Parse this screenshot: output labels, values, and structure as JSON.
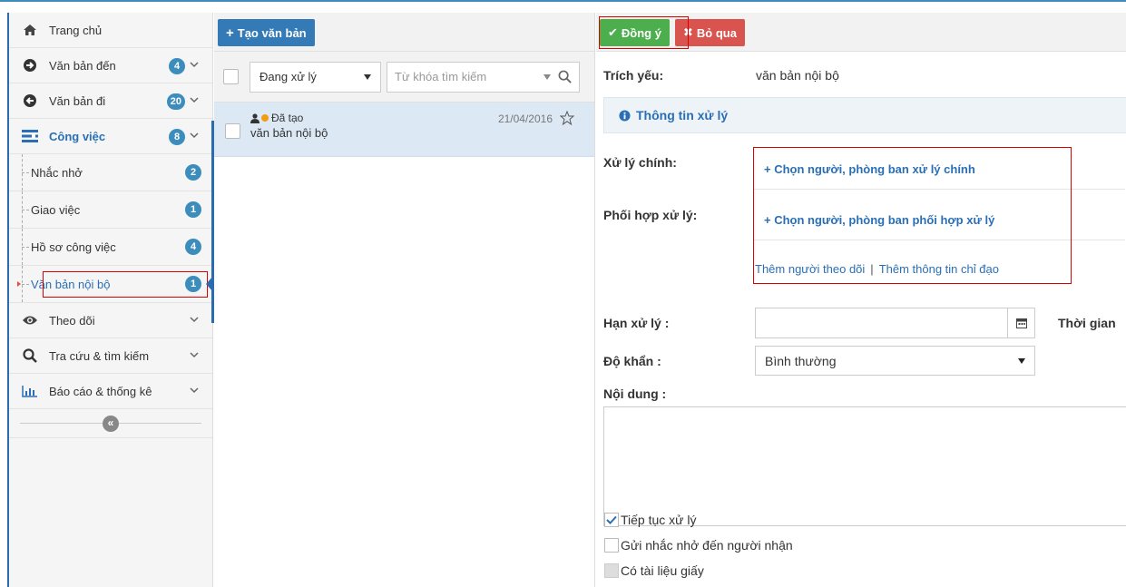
{
  "sidebar": {
    "items": [
      {
        "label": "Trang chủ",
        "icon": "home-icon"
      },
      {
        "label": "Văn bản đến",
        "icon": "arrow-circle-right-icon",
        "badge": "4"
      },
      {
        "label": "Văn bản đi",
        "icon": "arrow-circle-left-icon",
        "badge": "20"
      },
      {
        "label": "Công việc",
        "icon": "tasks-icon",
        "badge": "8"
      }
    ],
    "subitems": [
      {
        "label": "Nhắc nhở",
        "badge": "2"
      },
      {
        "label": "Giao việc",
        "badge": "1"
      },
      {
        "label": "Hồ sơ công việc",
        "badge": "4"
      },
      {
        "label": "Văn bản nội bộ",
        "badge": "1"
      }
    ],
    "more": [
      {
        "label": "Theo dõi",
        "icon": "eye-icon"
      },
      {
        "label": "Tra cứu & tìm kiếm",
        "icon": "search-icon"
      },
      {
        "label": "Báo cáo & thống kê",
        "icon": "bar-chart-icon"
      }
    ],
    "collapse": "«"
  },
  "list": {
    "create_label": "Tạo văn bản",
    "filter_value": "Đang xử lý",
    "search_placeholder": "Từ khóa tìm kiếm",
    "rows": [
      {
        "status": "Đã tạo",
        "title": "văn bản nội bộ",
        "date": "21/04/2016"
      }
    ]
  },
  "form": {
    "approve_label": "Đồng ý",
    "cancel_label": "Bỏ qua",
    "summary_label": "Trích yếu:",
    "summary_value": "văn bản nội bộ",
    "info_title": "Thông tin xử lý",
    "main_label": "Xử lý chính:",
    "main_pick": "+ Chọn người, phòng ban xử lý chính",
    "coop_label": "Phối hợp xử lý:",
    "coop_pick": "+ Chọn người, phòng ban phối hợp xử lý",
    "add_follower": "Thêm người theo dõi",
    "link_sep": "|",
    "add_direction": "Thêm thông tin chỉ đạo",
    "deadline_label": "Hạn xử lý :",
    "time_label": "Thời gian",
    "urgency_label": "Độ khẩn :",
    "urgency_value": "Bình thường",
    "content_label": "Nội dung :",
    "checkboxes": [
      {
        "label": "Tiếp tục xử lý",
        "checked": true
      },
      {
        "label": "Gửi nhắc nhở đến người nhận",
        "checked": false
      },
      {
        "label": "Có tài liệu giấy",
        "checked": false
      }
    ]
  },
  "colors": {
    "accent": "#337ab7",
    "success": "#4cae4c",
    "danger": "#d9534f",
    "badge": "#3c8dbc"
  }
}
